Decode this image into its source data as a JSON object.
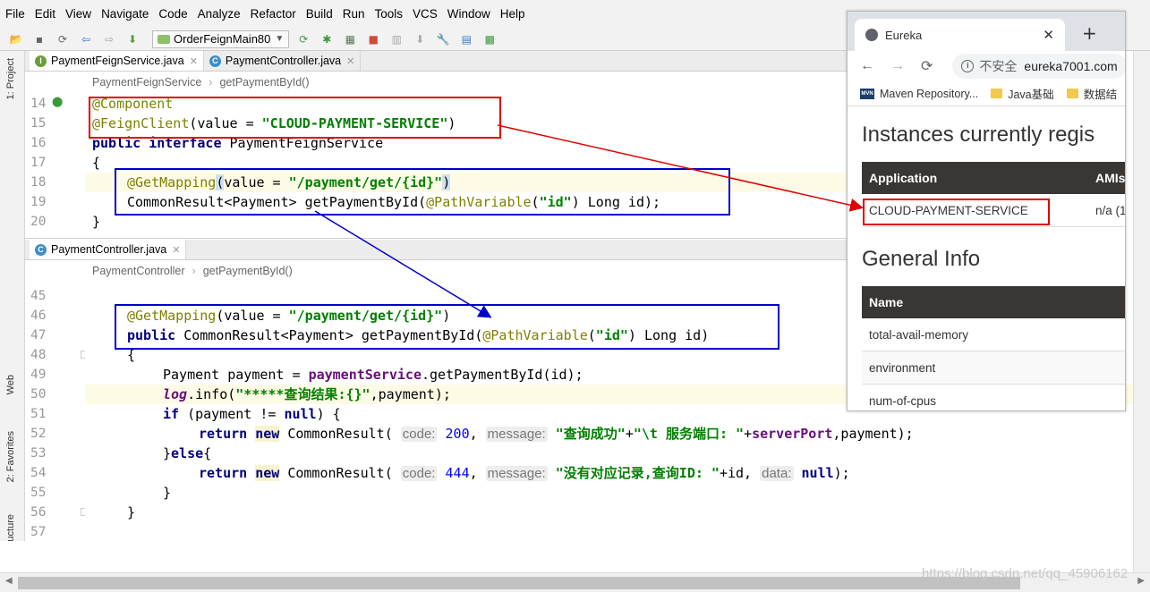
{
  "menu": [
    "File",
    "Edit",
    "View",
    "Navigate",
    "Code",
    "Analyze",
    "Refactor",
    "Build",
    "Run",
    "Tools",
    "VCS",
    "Window",
    "Help"
  ],
  "toolbar": {
    "run_config": "OrderFeignMain80"
  },
  "side_labels": {
    "project": "1: Project",
    "web": "Web",
    "favorites": "2: Favorites",
    "structure": "ucture"
  },
  "editor_top": {
    "tabs": [
      {
        "label": "PaymentFeignService.java",
        "icon": "I",
        "icon_color": "#6b9c3c",
        "active": true
      },
      {
        "label": "PaymentController.java",
        "icon": "C",
        "icon_color": "#3d8ec9",
        "active": false
      }
    ],
    "breadcrumbs": [
      "PaymentFeignService",
      "getPaymentById()"
    ],
    "line_numbers": [
      "14",
      "15",
      "16",
      "17",
      "18",
      "19",
      "20"
    ]
  },
  "editor_bottom": {
    "tabs": [
      {
        "label": "PaymentController.java",
        "icon": "C",
        "icon_color": "#3d8ec9",
        "active": true
      }
    ],
    "breadcrumbs": [
      "PaymentController",
      "getPaymentById()"
    ],
    "line_numbers": [
      "45",
      "46",
      "47",
      "48",
      "49",
      "50",
      "51",
      "52",
      "53",
      "54",
      "55",
      "56",
      "57"
    ]
  },
  "browser": {
    "tab_title": "Eureka",
    "security": "不安全",
    "host": "eureka7001.com",
    "bookmarks": [
      "Maven Repository...",
      "Java基础",
      "数据结"
    ],
    "heading_instances": "Instances currently regis",
    "table_headers": [
      "Application",
      "AMIs"
    ],
    "app_row": [
      "CLOUD-PAYMENT-SERVICE",
      "n/a (1"
    ],
    "heading_general": "General Info",
    "info_header": "Name",
    "info_rows": [
      "total-avail-memory",
      "environment",
      "num-of-cpus"
    ]
  },
  "watermark": "https://blog.csdn.net/qq_45906162",
  "colors": {
    "red_box": "#e00000",
    "blue_box": "#0000d0",
    "eureka_header": "#3a3633"
  }
}
